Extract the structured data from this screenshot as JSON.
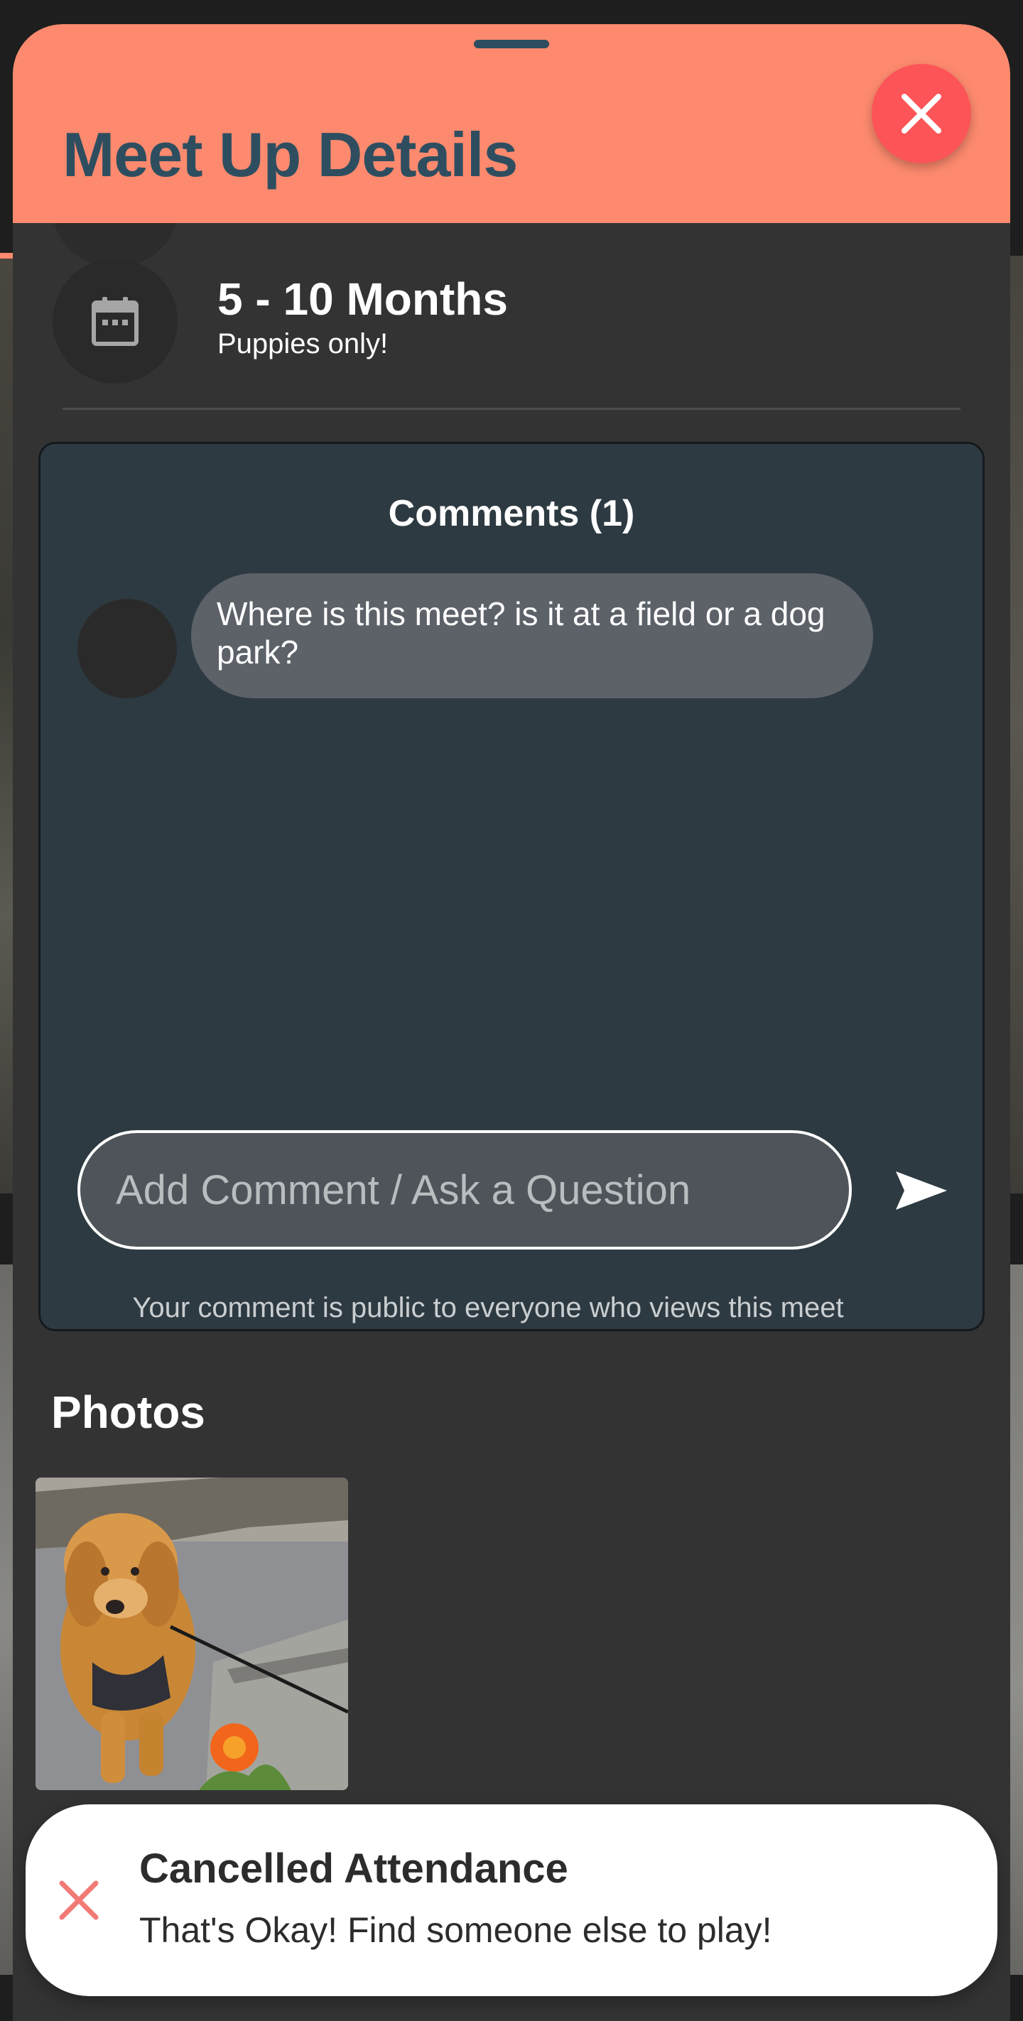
{
  "header": {
    "title": "Meet Up Details",
    "close_icon": "close-icon"
  },
  "age_group": {
    "icon": "calendar-icon",
    "title": "5 - 10 Months",
    "subtitle": "Puppies only!"
  },
  "comments": {
    "title": "Comments (1)",
    "items": [
      {
        "text": "Where is this meet? is it at a field or a dog park?"
      }
    ],
    "input_placeholder": "Add Comment / Ask a Question",
    "send_icon": "send-icon",
    "note": "Your comment is public to everyone who views this meet"
  },
  "photos": {
    "title": "Photos",
    "items": [
      {
        "subject": "golden retriever puppy with orange flower"
      }
    ]
  },
  "toast": {
    "icon": "x-icon",
    "title": "Cancelled Attendance",
    "message": "That's Okay! Find someone else to play!"
  },
  "colors": {
    "header_bg": "#fd8a6e",
    "title_color": "#2e4e60",
    "close_button": "#fd5457",
    "sheet_bg": "#333333",
    "comments_panel_bg": "#2e3a41",
    "toast_icon": "#f27a76"
  }
}
